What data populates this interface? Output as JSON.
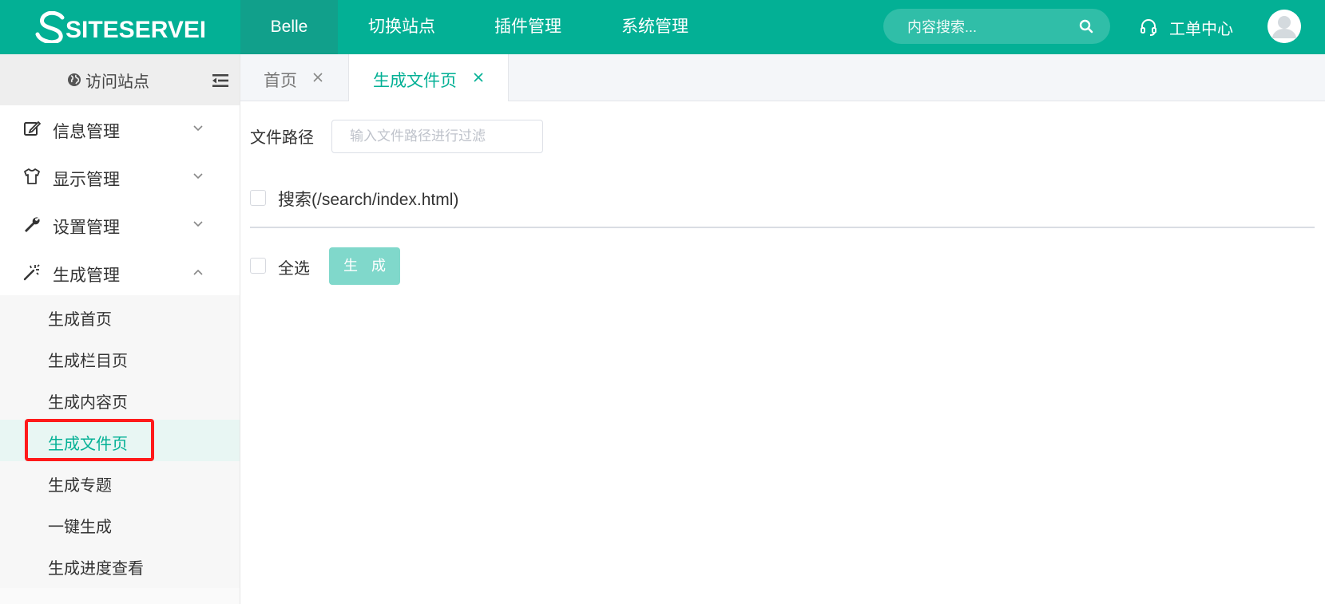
{
  "brand": {
    "logo_text": "SITESERVER"
  },
  "topnav": {
    "items": [
      {
        "label": "Belle",
        "active": true
      },
      {
        "label": "切换站点"
      },
      {
        "label": "插件管理"
      },
      {
        "label": "系统管理"
      }
    ],
    "search_placeholder": "内容搜索...",
    "ticket_label": "工单中心"
  },
  "sidebar": {
    "visit_label": "访问站点",
    "menus": [
      {
        "label": "信息管理",
        "icon": "edit-icon",
        "expanded": false
      },
      {
        "label": "显示管理",
        "icon": "tshirt-icon",
        "expanded": false
      },
      {
        "label": "设置管理",
        "icon": "wrench-icon",
        "expanded": false
      },
      {
        "label": "生成管理",
        "icon": "magic-wand-icon",
        "expanded": true
      }
    ],
    "submenu": [
      {
        "label": "生成首页"
      },
      {
        "label": "生成栏目页"
      },
      {
        "label": "生成内容页"
      },
      {
        "label": "生成文件页",
        "active": true
      },
      {
        "label": "生成专题"
      },
      {
        "label": "一键生成"
      },
      {
        "label": "生成进度查看"
      }
    ]
  },
  "tabs": [
    {
      "label": "首页",
      "active": false
    },
    {
      "label": "生成文件页",
      "active": true
    }
  ],
  "content": {
    "path_label": "文件路径",
    "path_placeholder": "输入文件路径进行过滤",
    "files": [
      {
        "label": "搜索(/search/index.html)",
        "checked": false
      }
    ],
    "select_all_label": "全选",
    "generate_button": "生 成"
  },
  "colors": {
    "brand": "#03b095",
    "active_bg": "#e8f6f3",
    "button_disabled": "#80d8cb",
    "highlight": "#ff1a1a"
  }
}
